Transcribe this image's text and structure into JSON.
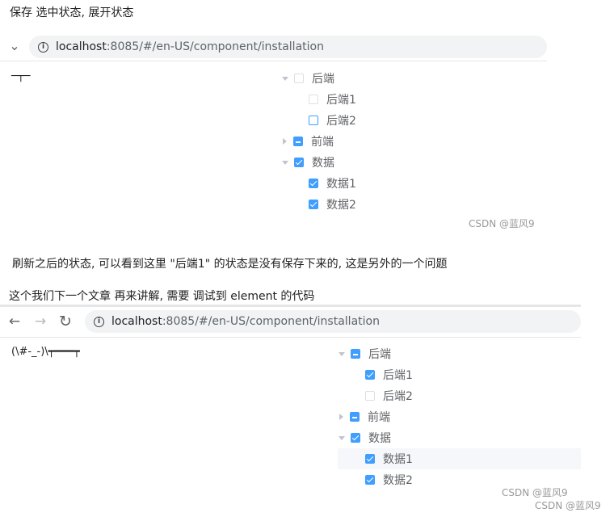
{
  "captions": {
    "c1": "保存 选中状态, 展开状态",
    "c2": "刷新之后的状态, 可以看到这里 \"后端1\" 的状态是没有保存下来的, 这是另外的一个问题",
    "c3": "这个我们下一个文章 再来讲解, 需要 调试到 element 的代码"
  },
  "browser1": {
    "nav_glyph": "⌄",
    "url_host": "localhost",
    "url_path": ":8085/#/en-US/component/installation"
  },
  "browser2": {
    "back": "←",
    "forward": "→",
    "reload": "↻",
    "url_host": "localhost",
    "url_path": ":8085/#/en-US/component/installation"
  },
  "ascii1": "─┬─",
  "ascii2": "(\\#-_-)\\┯━━━┯",
  "tree1": [
    {
      "label": "后端",
      "level": 0,
      "caret": "down",
      "state": "unchecked"
    },
    {
      "label": "后端1",
      "level": 1,
      "caret": "none",
      "state": "unchecked"
    },
    {
      "label": "后端2",
      "level": 1,
      "caret": "none",
      "state": "focus"
    },
    {
      "label": "前端",
      "level": 0,
      "caret": "right",
      "state": "indeterminate"
    },
    {
      "label": "数据",
      "level": 0,
      "caret": "down",
      "state": "checked"
    },
    {
      "label": "数据1",
      "level": 1,
      "caret": "none",
      "state": "checked"
    },
    {
      "label": "数据2",
      "level": 1,
      "caret": "none",
      "state": "checked"
    }
  ],
  "tree2": [
    {
      "label": "后端",
      "level": 0,
      "caret": "down",
      "state": "indeterminate"
    },
    {
      "label": "后端1",
      "level": 1,
      "caret": "none",
      "state": "checked"
    },
    {
      "label": "后端2",
      "level": 1,
      "caret": "none",
      "state": "unchecked"
    },
    {
      "label": "前端",
      "level": 0,
      "caret": "right",
      "state": "indeterminate"
    },
    {
      "label": "数据",
      "level": 0,
      "caret": "down",
      "state": "checked"
    },
    {
      "label": "数据1",
      "level": 1,
      "caret": "none",
      "state": "checked",
      "highlight": true
    },
    {
      "label": "数据2",
      "level": 1,
      "caret": "none",
      "state": "checked"
    }
  ],
  "watermarks": {
    "w1": "CSDN @蓝风9",
    "w2": "CSDN @蓝风9",
    "w3": "CSDN @蓝风9"
  },
  "colors": {
    "primary": "#409eff",
    "border": "#dcdfe6",
    "text": "#606266",
    "highlight_row": "#f5f7fa",
    "address_bar": "#f1f3f4"
  }
}
